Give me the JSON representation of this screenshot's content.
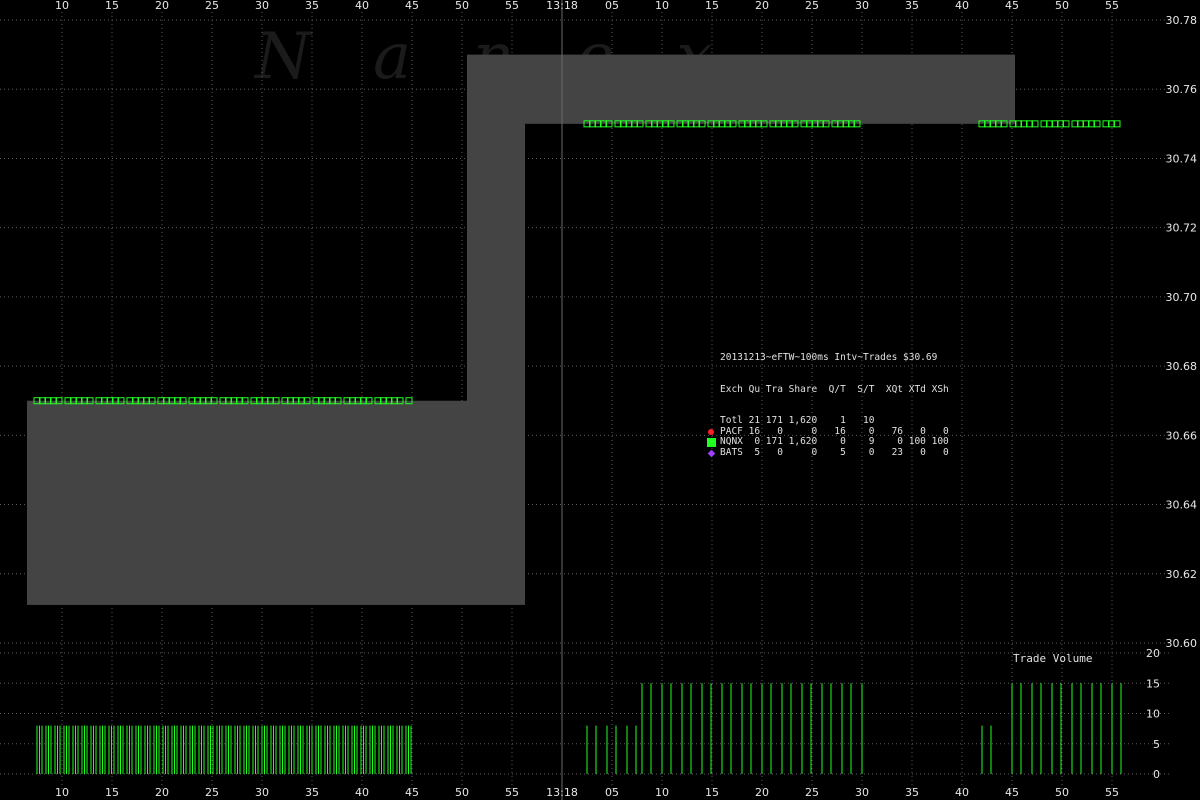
{
  "watermark": "Nanex",
  "time_marker": "13:18",
  "legend_title": "20131213~eFTW~100ms Intv~Trades $30.69",
  "stats_header": [
    "Exch",
    "Qu",
    "Tra",
    "Share",
    "Q/T",
    "S/T",
    "XQt",
    "XTd",
    "XSh"
  ],
  "stats_rows": [
    {
      "exch": "Totl",
      "qu": "21",
      "tra": "171",
      "share": "1,620",
      "qt": "1",
      "st": "10",
      "xqt": "",
      "xtd": "",
      "xsh": "",
      "marker": "none",
      "color": ""
    },
    {
      "exch": "PACF",
      "qu": "16",
      "tra": "0",
      "share": "0",
      "qt": "16",
      "st": "0",
      "xqt": "76",
      "xtd": "0",
      "xsh": "0",
      "marker": "dot",
      "color": "#ff2020"
    },
    {
      "exch": "NQNX",
      "qu": "0",
      "tra": "171",
      "share": "1,620",
      "qt": "0",
      "st": "9",
      "xqt": "0",
      "xtd": "100",
      "xsh": "100",
      "marker": "square",
      "color": "#22ff22"
    },
    {
      "exch": "BATS",
      "qu": "5",
      "tra": "0",
      "share": "0",
      "qt": "5",
      "st": "0",
      "xqt": "23",
      "xtd": "0",
      "xsh": "0",
      "marker": "diamond",
      "color": "#a040ff"
    }
  ],
  "volume_title": "Trade Volume",
  "colors": {
    "background": "#000000",
    "bbo_band": "#444444",
    "trade": "#22ff22"
  },
  "chart_data": {
    "type": "line",
    "xlabel": "",
    "ylabel": "",
    "x_tick_labels": [
      "10",
      "15",
      "20",
      "25",
      "30",
      "35",
      "40",
      "45",
      "50",
      "55",
      "13:18",
      "05",
      "10",
      "15",
      "20",
      "25",
      "30",
      "35",
      "40",
      "45",
      "50",
      "55"
    ],
    "ylim": [
      30.6,
      30.78
    ],
    "y_ticks": [
      "30.60",
      "30.62",
      "30.64",
      "30.66",
      "30.68",
      "30.70",
      "30.72",
      "30.74",
      "30.76",
      "30.78"
    ],
    "bbo_band": [
      {
        "t_start": 6.5,
        "t_end": 50.5,
        "bid": 30.611,
        "ask": 30.67
      },
      {
        "t_start": 50.5,
        "t_end": 56.3,
        "bid": 30.611,
        "ask": 30.77
      },
      {
        "t_start": 56.3,
        "t_end": 105.3,
        "bid": 30.75,
        "ask": 30.77
      }
    ],
    "trade_prices": [
      {
        "t_start": 7.5,
        "t_end": 45,
        "price": 30.67
      },
      {
        "t_start": 62.5,
        "t_end": 90,
        "price": 30.75
      },
      {
        "t_start": 102,
        "t_end": 116,
        "price": 30.75
      }
    ],
    "volume_ylim": [
      0,
      20
    ],
    "volume_ticks": [
      "0",
      "5",
      "10",
      "15",
      "20"
    ],
    "volume_segments": [
      {
        "t_start": 7.5,
        "t_end": 45,
        "volume": 8
      },
      {
        "t_start": 62.5,
        "t_end": 68,
        "volume": 8
      },
      {
        "t_start": 68,
        "t_end": 90,
        "volume": 15
      },
      {
        "t_start": 102,
        "t_end": 103.5,
        "volume": 8
      },
      {
        "t_start": 105,
        "t_end": 116,
        "volume": 15
      }
    ]
  }
}
